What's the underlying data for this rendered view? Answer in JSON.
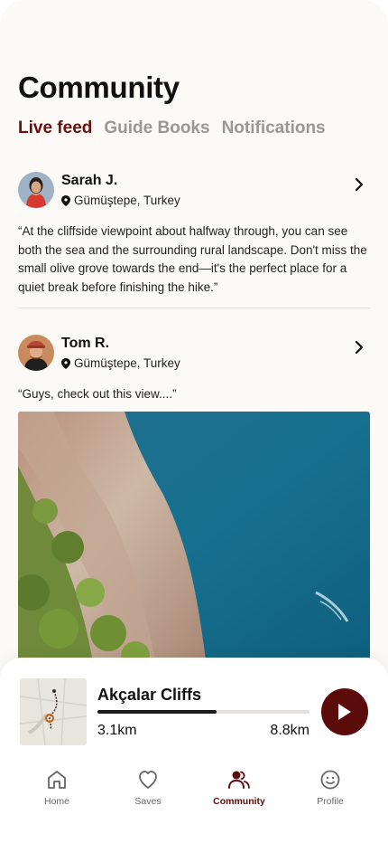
{
  "page": {
    "title": "Community"
  },
  "tabs": [
    {
      "label": "Live feed",
      "active": true
    },
    {
      "label": "Guide Books",
      "active": false
    },
    {
      "label": "Notifications",
      "active": false
    }
  ],
  "posts": [
    {
      "author": "Sarah J.",
      "location": "Gümüştepe, Turkey",
      "text": "“At the cliffside viewpoint about halfway through, you can see both the sea and the surrounding rural landscape. Don't miss the small olive grove towards the end—it's the perfect place for a quiet break before finishing the hike.”"
    },
    {
      "author": "Tom R.",
      "location": "Gümüştepe, Turkey",
      "text": "“Guys, check out this view....”"
    }
  ],
  "player": {
    "trail_name": "Akçalar Cliffs",
    "current_distance": "3.1km",
    "total_distance": "8.8km",
    "progress": 0.56
  },
  "nav": [
    {
      "label": "Home",
      "icon": "home-icon",
      "active": false
    },
    {
      "label": "Saves",
      "icon": "heart-icon",
      "active": false
    },
    {
      "label": "Community",
      "icon": "community-icon",
      "active": true
    },
    {
      "label": "Profile",
      "icon": "smiley-icon",
      "active": false
    }
  ],
  "colors": {
    "accent": "#6b0e0e",
    "play_button": "#5c0b0b",
    "inactive_tab": "#9a9693"
  }
}
